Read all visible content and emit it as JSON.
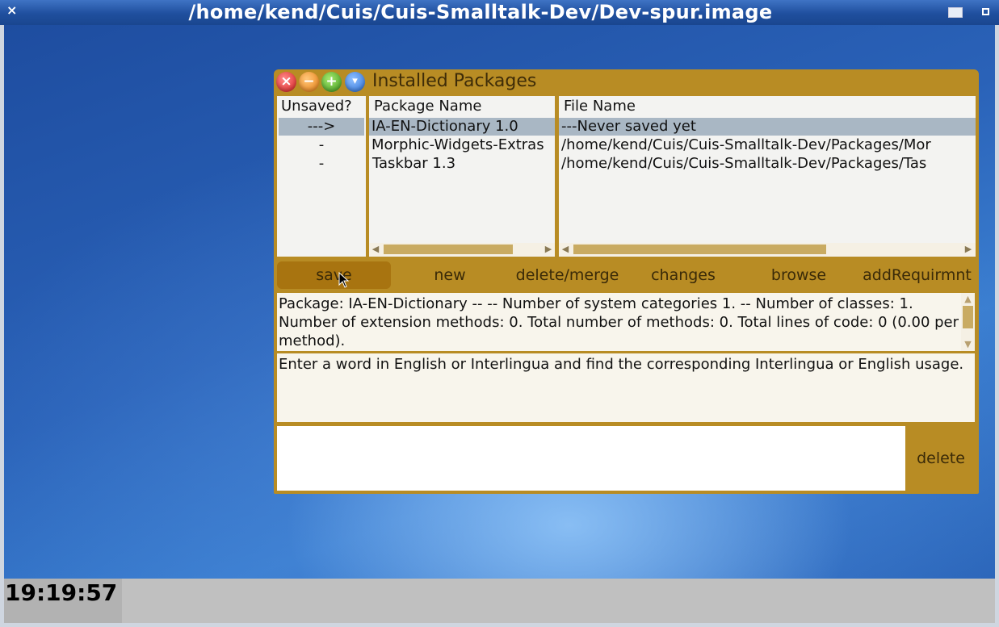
{
  "os_window": {
    "title": "/home/kend/Cuis/Cuis-Smalltalk-Dev/Dev-spur.image",
    "close_glyph": "×"
  },
  "window": {
    "title": "Installed Packages",
    "close_glyph": "×",
    "minimize_glyph": "−",
    "maximize_glyph": "+",
    "menu_glyph": "▾"
  },
  "columns": {
    "unsaved": "Unsaved?",
    "package_name": "Package Name",
    "file_name": "File Name"
  },
  "packages": [
    {
      "unsaved": "--->",
      "name": "IA-EN-Dictionary 1.0",
      "file": "---Never saved yet",
      "selected": true
    },
    {
      "unsaved": "-",
      "name": "Morphic-Widgets-Extras",
      "file": "/home/kend/Cuis/Cuis-Smalltalk-Dev/Packages/Mor",
      "selected": false
    },
    {
      "unsaved": "-",
      "name": "Taskbar 1.3",
      "file": "/home/kend/Cuis/Cuis-Smalltalk-Dev/Packages/Tas",
      "selected": false
    }
  ],
  "toolbar": {
    "save": "save",
    "new": "new",
    "delete_merge": "delete/merge",
    "changes": "changes",
    "browse": "browse",
    "add_requirement": "addRequirmnt"
  },
  "summary": "Package: IA-EN-Dictionary --  -- Number of system categories 1. -- Number of classes: 1. Number of extension methods: 0. Total number of methods: 0. Total lines of code: 0 (0.00 per method).",
  "description": "Enter a word in English or Interlingua and find the corresponding Interlingua or English usage.",
  "requirements": {
    "delete": "delete"
  },
  "taskbar": {
    "clock": "19:19:57"
  },
  "colors": {
    "window_frame": "#b88c24",
    "selection": "#a9b7c4",
    "save_button": "#a87410",
    "desktop": "#2a62b8"
  },
  "icons": [
    "close-icon",
    "minimize-icon",
    "maximize-icon",
    "menu-icon",
    "scroll-left-icon",
    "scroll-right-icon",
    "scroll-up-icon",
    "scroll-down-icon",
    "mouse-cursor-icon"
  ]
}
